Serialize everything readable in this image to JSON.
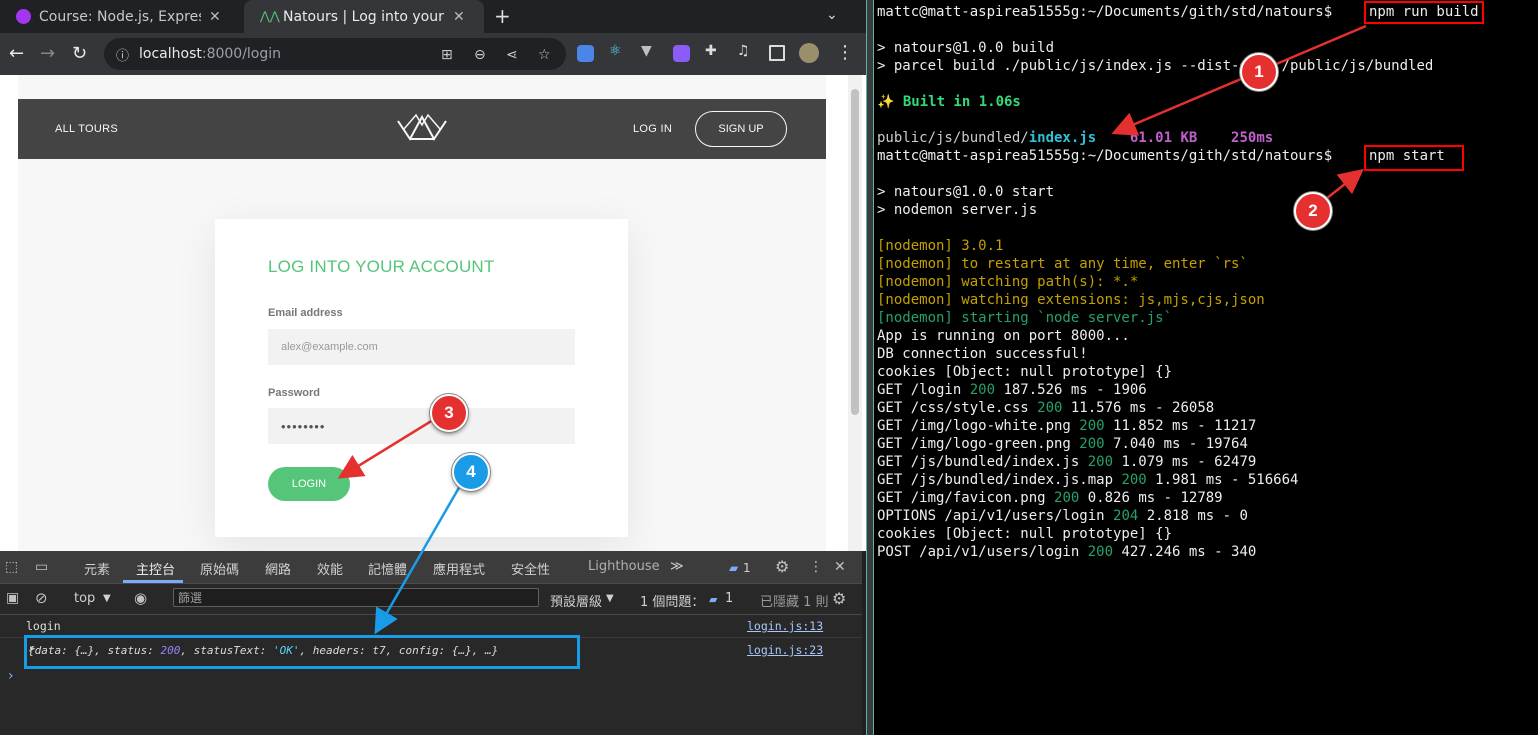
{
  "browser": {
    "tabs": [
      {
        "title": "Course: Node.js, Express",
        "favicon_color": "#a435f0"
      },
      {
        "title": "Natours | Log into your a",
        "favicon_color": "#55c57a"
      }
    ],
    "new_tab": "+",
    "tab_menu": "⌄",
    "url_host": "localhost",
    "url_path": ":8000/login"
  },
  "site": {
    "nav_all_tours": "ALL TOURS",
    "nav_login": "LOG IN",
    "nav_signup": "SIGN UP",
    "heading": "LOG INTO YOUR ACCOUNT",
    "email_label": "Email address",
    "email_placeholder": "alex@example.com",
    "password_label": "Password",
    "password_value": "••••••••",
    "login_button": "LOGIN"
  },
  "devtools": {
    "tabs": [
      "元素",
      "主控台",
      "原始碼",
      "網路",
      "效能",
      "記憶體",
      "應用程式",
      "安全性",
      "Lighthouse"
    ],
    "more_tabs": "≫",
    "issue_badge": "1",
    "context": "top",
    "filter_placeholder": "篩選",
    "levels": "預設層級",
    "issues": "1 個問題：",
    "issues_count": "1",
    "hidden": "已隱藏 1 則",
    "log_text": "login",
    "log_source": "login.js:13",
    "obj_source": "login.js:23",
    "obj": {
      "open": "{data: {…}, status: ",
      "status": "200",
      "mid": ", statusText: ",
      "statusText": "'OK'",
      "tail": ", headers: t7, config: {…}, …}"
    },
    "prompt": "›"
  },
  "terminal": {
    "prompt": "mattc@matt-aspirea51555g:~/Documents/gith/std/natours$",
    "cmd_build": "npm run build",
    "build_1": "> natours@1.0.0 build",
    "build_2": "> parcel build ./public/js/index.js --dist-dir ./public/js/bundled",
    "built": "✨ Built in 1.06s",
    "bundle_path": "public/js/bundled/",
    "bundle_file": "index.js",
    "bundle_size": "61.01 KB",
    "bundle_time": "250ms",
    "cmd_start": "npm start",
    "start_1": "> natours@1.0.0 start",
    "start_2": "> nodemon server.js",
    "nodemon": [
      "[nodemon] 3.0.1",
      "[nodemon] to restart at any time, enter `rs`",
      "[nodemon] watching path(s): *.*",
      "[nodemon] watching extensions: js,mjs,cjs,json"
    ],
    "nodemon_start": "[nodemon] starting `node server.js`",
    "app_running": "App is running on port 8000...",
    "db": "DB connection successful!",
    "cookies1": "cookies [Object: null prototype] {}",
    "requests": [
      {
        "pre": "GET /login ",
        "code": "200",
        "post": " 187.526 ms - 1906"
      },
      {
        "pre": "GET /css/style.css ",
        "code": "200",
        "post": " 11.576 ms - 26058"
      },
      {
        "pre": "GET /img/logo-white.png ",
        "code": "200",
        "post": " 11.852 ms - 11217"
      },
      {
        "pre": "GET /img/logo-green.png ",
        "code": "200",
        "post": " 7.040 ms - 19764"
      },
      {
        "pre": "GET /js/bundled/index.js ",
        "code": "200",
        "post": " 1.079 ms - 62479"
      },
      {
        "pre": "GET /js/bundled/index.js.map ",
        "code": "200",
        "post": " 1.981 ms - 516664"
      },
      {
        "pre": "GET /img/favicon.png ",
        "code": "200",
        "post": " 0.826 ms - 12789"
      },
      {
        "pre": "OPTIONS /api/v1/users/login ",
        "code": "204",
        "post": " 2.818 ms - 0"
      }
    ],
    "cookies2": "cookies [Object: null prototype] {}",
    "post": {
      "pre": "POST /api/v1/users/login ",
      "code": "200",
      "post": " 427.246 ms - 340"
    }
  },
  "annotations": [
    "1",
    "2",
    "3",
    "4"
  ],
  "colors": {
    "annotation_red": "#e53030",
    "annotation_blue": "#1a9be8",
    "brand_green": "#55c57a"
  }
}
